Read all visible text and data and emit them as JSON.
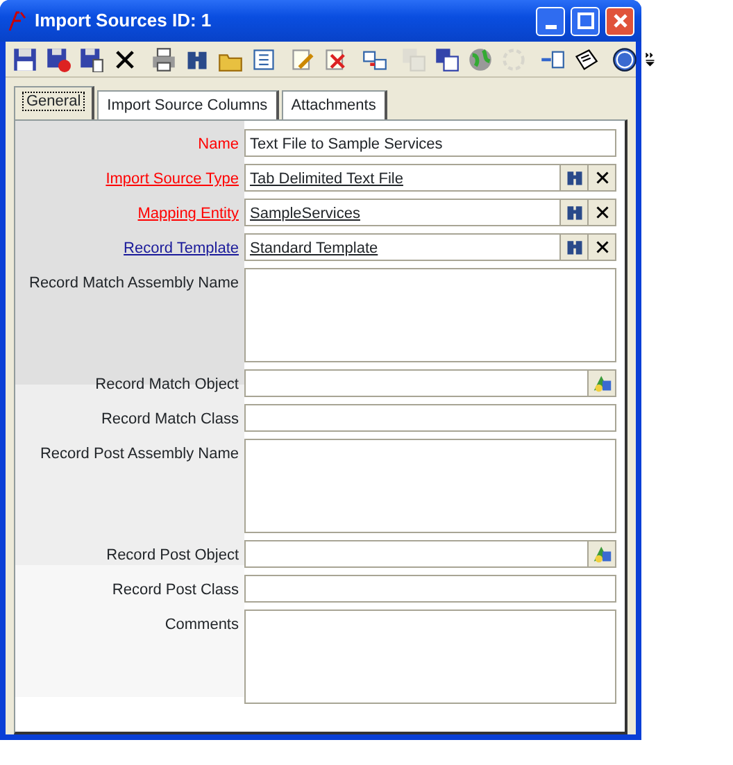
{
  "window": {
    "title": "Import Sources ID: 1"
  },
  "toolbar": [
    {
      "disabled": false
    },
    {
      "disabled": false
    },
    {
      "disabled": false
    },
    {
      "disabled": false
    },
    {
      "disabled": false
    },
    {
      "disabled": false
    },
    {
      "disabled": false
    },
    {
      "disabled": false
    },
    {
      "disabled": false
    },
    {
      "disabled": false
    },
    {
      "disabled": false
    },
    {
      "disabled": true
    },
    {
      "disabled": false
    },
    {
      "disabled": false
    },
    {
      "disabled": true
    },
    {
      "disabled": false
    },
    {
      "disabled": false
    },
    {
      "disabled": false
    }
  ],
  "tabs": [
    {
      "label": "General",
      "selected": true
    },
    {
      "label": "Import Source Columns",
      "selected": false
    },
    {
      "label": "Attachments",
      "selected": false
    }
  ],
  "fields": [
    {
      "label": "Name",
      "required": true,
      "link": false,
      "kind": "text",
      "value": "Text File to Sample Services"
    },
    {
      "label": "Import Source Type",
      "required": true,
      "link": true,
      "kind": "lookup",
      "value": "Tab Delimited Text File"
    },
    {
      "label": "Mapping Entity",
      "required": true,
      "link": true,
      "kind": "lookup",
      "value": "SampleServices"
    },
    {
      "label": "Record Template",
      "required": false,
      "link": true,
      "kind": "lookup",
      "value": "Standard Template"
    },
    {
      "label": "Record Match Assembly Name",
      "required": false,
      "link": false,
      "kind": "multiline"
    },
    {
      "label": "Record Match Object",
      "required": false,
      "link": false,
      "kind": "object"
    },
    {
      "label": "Record Match Class",
      "required": false,
      "link": false,
      "kind": "text"
    },
    {
      "label": "Record Post Assembly Name",
      "required": false,
      "link": false,
      "kind": "multiline"
    },
    {
      "label": "Record Post Object",
      "required": false,
      "link": false,
      "kind": "object"
    },
    {
      "label": "Record Post Class",
      "required": false,
      "link": false,
      "kind": "text"
    },
    {
      "label": "Comments",
      "required": false,
      "link": false,
      "kind": "multiline"
    }
  ]
}
